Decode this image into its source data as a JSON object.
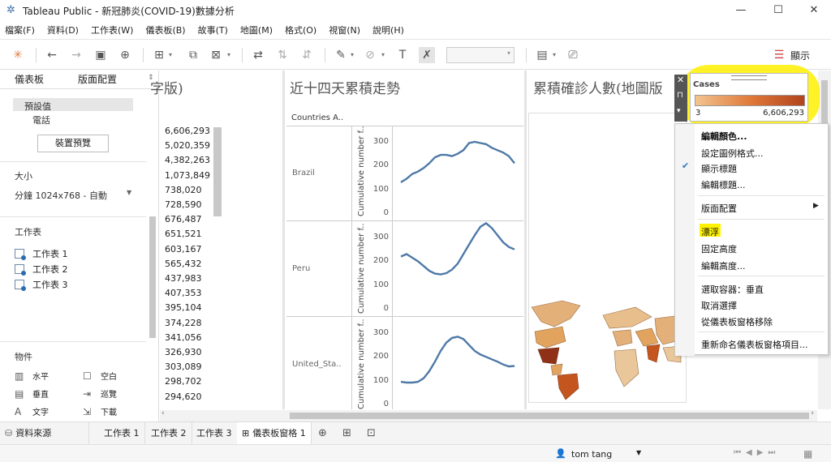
{
  "window": {
    "title": "Tableau Public - 新冠肺炎(COVID-19)數據分析",
    "controls": [
      "—",
      "☐",
      "✕"
    ]
  },
  "menu": [
    "檔案(F)",
    "資料(D)",
    "工作表(W)",
    "儀表板(B)",
    "故事(T)",
    "地圖(M)",
    "格式(O)",
    "視窗(N)",
    "說明(H)"
  ],
  "toolbar": {
    "show_label": "顯示"
  },
  "left_panel": {
    "tabs": [
      "儀表板",
      "版面配置"
    ],
    "device": {
      "default": "預設值",
      "phone": "電話",
      "preview_button": "裝置預覽"
    },
    "size": {
      "heading": "大小",
      "value": "分鐘 1024x768 - 自動"
    },
    "sheets": {
      "heading": "工作表",
      "items": [
        "工作表 1",
        "工作表 2",
        "工作表 3"
      ]
    },
    "objects": {
      "heading": "物件",
      "items": [
        {
          "label": "水平",
          "icon": "horizontal-icon"
        },
        {
          "label": "空白",
          "icon": "blank-icon"
        },
        {
          "label": "垂直",
          "icon": "vertical-icon"
        },
        {
          "label": "巡覽",
          "icon": "navigation-icon"
        },
        {
          "label": "文字",
          "icon": "text-icon"
        },
        {
          "label": "下載",
          "icon": "download-icon"
        }
      ]
    }
  },
  "dashboard": {
    "panel1": {
      "title_fragment": "字版)",
      "values": [
        "6,606,293",
        "5,020,359",
        "4,382,263",
        "1,073,849",
        "738,020",
        "728,590",
        "676,487",
        "651,521",
        "603,167",
        "565,432",
        "437,983",
        "407,353",
        "395,104",
        "374,228",
        "341,056",
        "326,930",
        "303,089",
        "298,702",
        "294,620"
      ]
    },
    "panel2": {
      "title": "近十四天累積走勢",
      "column_header": "Countries A..",
      "y_title": "Cumulative number f..",
      "rows": [
        "Brazil",
        "Peru",
        "United_Sta.."
      ],
      "ticks": [
        "300",
        "200",
        "100",
        "0"
      ]
    },
    "panel3": {
      "title": "累積確診人數(地圖版"
    }
  },
  "legend": {
    "title": "Cases",
    "min": "3",
    "max": "6,606,293"
  },
  "context_menu": {
    "items": [
      {
        "label": "編輯顏色...",
        "bold": true
      },
      {
        "label": "設定圖例格式..."
      },
      {
        "label": "顯示標題",
        "checked": true
      },
      {
        "label": "編輯標題..."
      },
      {
        "label": "版面配置",
        "submenu": true
      },
      {
        "label": "漂浮",
        "highlight": true
      },
      {
        "label": "固定高度"
      },
      {
        "label": "編輯高度..."
      },
      {
        "label": "選取容器：垂直"
      },
      {
        "label": "取消選擇"
      },
      {
        "label": "從儀表板窗格移除"
      },
      {
        "label": "重新命名儀表板窗格項目..."
      }
    ]
  },
  "sheet_tabs": [
    "資料來源",
    "工作表 1",
    "工作表 2",
    "工作表 3",
    "儀表板窗格 1"
  ],
  "status": {
    "user": "tom tang"
  },
  "chart_data": [
    {
      "type": "line",
      "title": "",
      "ylabel": "Cumulative number f..",
      "ylim": [
        0,
        300
      ],
      "series": [
        {
          "name": "Brazil",
          "values": [
            130,
            145,
            165,
            175,
            190,
            210,
            235,
            245,
            245,
            240,
            250,
            265,
            295,
            300,
            295,
            290,
            275,
            265,
            255,
            240,
            210
          ]
        },
        {
          "name": "Peru",
          "values": [
            220,
            230,
            215,
            200,
            180,
            160,
            148,
            145,
            150,
            165,
            190,
            230,
            270,
            310,
            345,
            360,
            340,
            310,
            280,
            260,
            250
          ]
        },
        {
          "name": "United_Sta..",
          "values": [
            95,
            92,
            92,
            95,
            110,
            140,
            180,
            225,
            260,
            280,
            285,
            275,
            250,
            225,
            210,
            200,
            190,
            180,
            168,
            160,
            162
          ]
        }
      ]
    }
  ],
  "colors": {
    "accent": "#4e79a7",
    "line": "#4e79a7",
    "highlight": "#fff200",
    "legend_low": "#f2c48f",
    "legend_high": "#b2431e"
  }
}
